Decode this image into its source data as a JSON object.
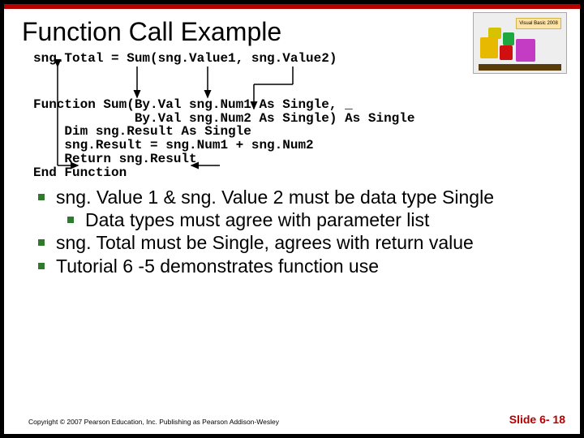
{
  "title": "Function Call Example",
  "logo_text": "Visual Basic 2008",
  "code": {
    "l1": "sng.Total = Sum(sng.Value1, sng.Value2)",
    "l2": "Function Sum(By.Val sng.Num1 As Single, _",
    "l3": "             By.Val sng.Num2 As Single) As Single",
    "l4": "    Dim sng.Result As Single",
    "l5": "    sng.Result = sng.Num1 + sng.Num2",
    "l6": "    Return sng.Result",
    "l7": "End Function"
  },
  "bullets": [
    "sng. Value 1 & sng. Value 2 must be data type Single",
    "Data types must agree with parameter list",
    "sng. Total must be Single, agrees with return value",
    "Tutorial 6 -5 demonstrates function use"
  ],
  "footer_left": "Copyright © 2007 Pearson Education, Inc. Publishing as Pearson Addison-Wesley",
  "footer_right": "Slide 6- 18"
}
